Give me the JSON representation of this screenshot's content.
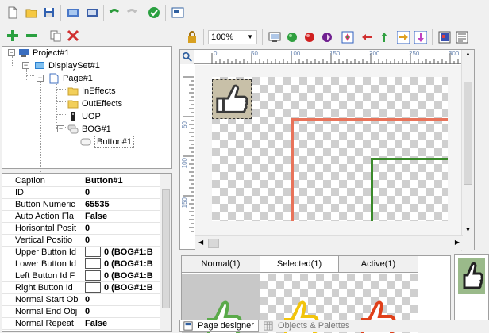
{
  "tree": {
    "nodes": [
      {
        "label": "Project#1"
      },
      {
        "label": "DisplaySet#1"
      },
      {
        "label": "Page#1"
      },
      {
        "label": "InEffects"
      },
      {
        "label": "OutEffects"
      },
      {
        "label": "UOP"
      },
      {
        "label": "BOG#1"
      },
      {
        "label": "Button#1"
      }
    ]
  },
  "properties": [
    {
      "name": "Caption",
      "value": "Button#1"
    },
    {
      "name": "ID",
      "value": "0"
    },
    {
      "name": "Button Numeric",
      "value": "65535"
    },
    {
      "name": "Auto Action Fla",
      "value": "False"
    },
    {
      "name": "Horisontal Posit",
      "value": "0"
    },
    {
      "name": "Vertical Positio",
      "value": "0"
    },
    {
      "name": "Upper Button Id",
      "value": "0 (BOG#1:B"
    },
    {
      "name": "Lower Button Id",
      "value": "0 (BOG#1:B"
    },
    {
      "name": "Left Button Id F",
      "value": "0 (BOG#1:B"
    },
    {
      "name": "Right Button Id",
      "value": "0 (BOG#1:B"
    },
    {
      "name": "Normal Start Ob",
      "value": "0"
    },
    {
      "name": "Normal End Obj",
      "value": "0"
    },
    {
      "name": "Normal Repeat",
      "value": "False"
    }
  ],
  "designer": {
    "zoom": "100%",
    "ruler_h": [
      "0",
      "50",
      "100",
      "150",
      "200",
      "250",
      "300"
    ],
    "ruler_v": [
      "50",
      "100",
      "150"
    ]
  },
  "state_tabs": [
    {
      "label": "Normal(1)"
    },
    {
      "label": "Selected(1)"
    },
    {
      "label": "Active(1)"
    }
  ],
  "bottom_tabs": {
    "page_designer": "Page designer",
    "objects_palettes": "Objects & Palettes"
  },
  "colors": {
    "line_red": "#e8735a",
    "line_green": "#3a8a2a",
    "selected_outline": "#f2c40c",
    "active_outline": "#e0401a",
    "normal_outline": "#5aaa4a"
  }
}
